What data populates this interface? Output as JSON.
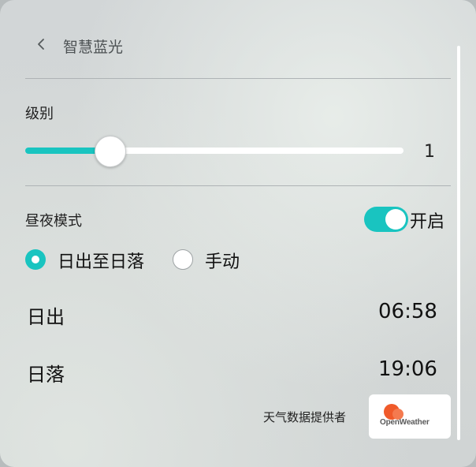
{
  "header": {
    "back_icon": "chevron-left-icon",
    "title": "智慧蓝光"
  },
  "level": {
    "label": "级别",
    "value": "1",
    "slider_fraction": 0.23
  },
  "day_night": {
    "label": "昼夜模式",
    "toggle_state": "on",
    "toggle_label": "开启",
    "options": [
      "日出至日落",
      "手动"
    ],
    "selected_option": "日出至日落"
  },
  "sunrise": {
    "label": "日出",
    "time": "06:58"
  },
  "sunset": {
    "label": "日落",
    "time": "19:06"
  },
  "provider": {
    "label": "天气数据提供者",
    "logo_text": "OpenWeather"
  },
  "colors": {
    "accent": "#19c4c0",
    "logo_orange": "#f05a2a"
  }
}
